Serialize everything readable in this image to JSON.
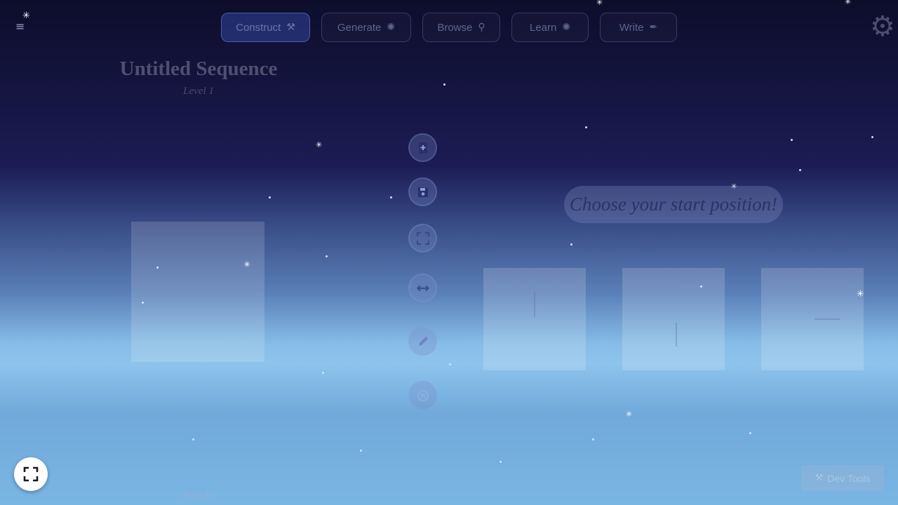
{
  "nav": {
    "menu_icon": "menu-icon",
    "tabs": [
      {
        "label": "Construct",
        "icon": "hammer-icon",
        "glyph": "⚒",
        "active": true
      },
      {
        "label": "Generate",
        "icon": "brain-icon",
        "glyph": "✺",
        "active": false
      },
      {
        "label": "Browse",
        "icon": "search-icon",
        "glyph": "⚲",
        "active": false
      },
      {
        "label": "Learn",
        "icon": "brain-icon",
        "glyph": "✺",
        "active": false
      },
      {
        "label": "Write",
        "icon": "pen-icon",
        "glyph": "✒",
        "active": false
      }
    ],
    "settings_icon": "gear-icon"
  },
  "sequence": {
    "title": "Untitled Sequence",
    "level": "Level 1",
    "status": "Ready"
  },
  "tools": [
    {
      "icon": "add-to-dictionary-icon"
    },
    {
      "icon": "save-icon"
    },
    {
      "icon": "fullscreen-icon"
    },
    {
      "icon": "mirror-icon"
    },
    {
      "icon": "color-swap-icon"
    },
    {
      "icon": "clear-icon"
    }
  ],
  "start_picker": {
    "prompt": "Choose your start position!",
    "options": [
      {
        "name": "start-position-alpha"
      },
      {
        "name": "start-position-beta"
      },
      {
        "name": "start-position-gamma"
      }
    ]
  },
  "footer": {
    "fullscreen_icon": "expand-icon",
    "dev_tools_label": "Dev Tools",
    "dev_tools_icon": "tools-icon"
  },
  "colors": {
    "sky_top": "#0d0d2b",
    "sky_mid": "#1c1c55",
    "sky_horizon": "#8ec4ec",
    "active_tab": "#283782"
  }
}
